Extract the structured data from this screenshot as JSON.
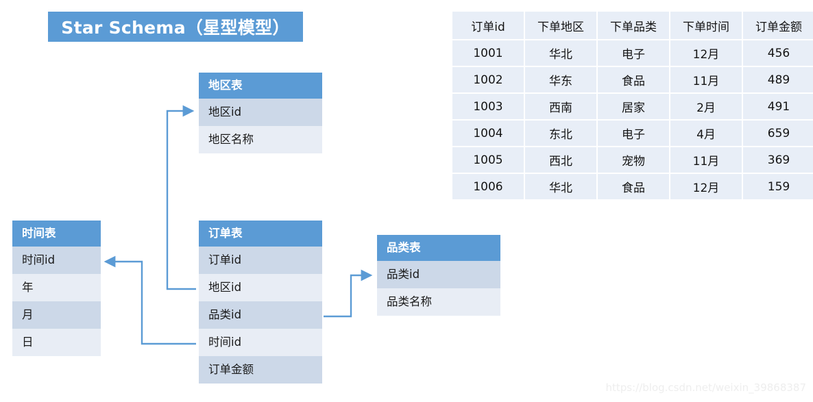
{
  "title": {
    "text": "Star Schema（星型模型）",
    "background": "#5b9bd5",
    "color": "#ffffff"
  },
  "colors": {
    "header_blue": "#5b9bd5",
    "row_dark": "#ccd8e8",
    "row_light": "#e8edf5",
    "data_cell": "#e8eef7",
    "connector": "#5b9bd5",
    "watermark": "#eeeeee"
  },
  "entities": {
    "region": {
      "name": "地区表",
      "fields": [
        "地区id",
        "地区名称"
      ]
    },
    "time": {
      "name": "时间表",
      "fields": [
        "时间id",
        "年",
        "月",
        "日"
      ]
    },
    "order": {
      "name": "订单表",
      "fields": [
        "订单id",
        "地区id",
        "品类id",
        "时间id",
        "订单金额"
      ]
    },
    "category": {
      "name": "品类表",
      "fields": [
        "品类id",
        "品类名称"
      ]
    }
  },
  "data_table": {
    "columns": [
      "订单id",
      "下单地区",
      "下单品类",
      "下单时间",
      "订单金额"
    ],
    "rows": [
      [
        "1001",
        "华北",
        "电子",
        "12月",
        "456"
      ],
      [
        "1002",
        "华东",
        "食品",
        "11月",
        "489"
      ],
      [
        "1003",
        "西南",
        "居家",
        "2月",
        "491"
      ],
      [
        "1004",
        "东北",
        "电子",
        "4月",
        "659"
      ],
      [
        "1005",
        "西北",
        "宠物",
        "11月",
        "369"
      ],
      [
        "1006",
        "华北",
        "食品",
        "12月",
        "159"
      ]
    ]
  },
  "relationships": [
    {
      "from": "订单表.地区id",
      "to": "地区表.地区id"
    },
    {
      "from": "订单表.品类id",
      "to": "品类表.品类id"
    },
    {
      "from": "订单表.时间id",
      "to": "时间表.时间id"
    }
  ],
  "watermark": {
    "text": "https://blog.csdn.net/weixin_39868387"
  }
}
